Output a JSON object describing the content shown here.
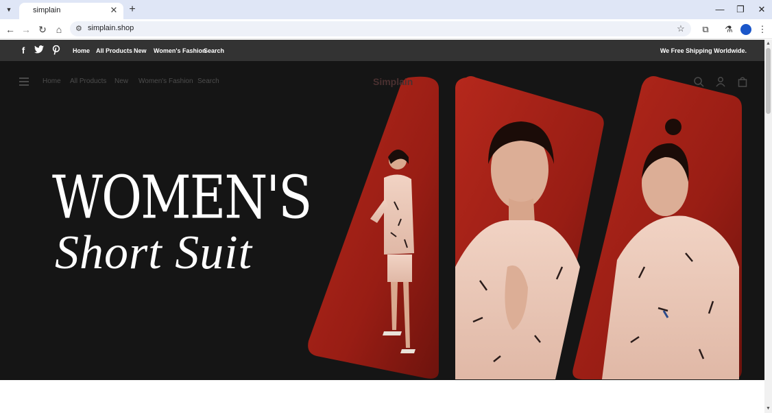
{
  "browser": {
    "tab_title": "simplain",
    "url": "simplain.shop",
    "icons": {
      "tab_list": "chevron-down-icon",
      "close": "close-icon",
      "new_tab": "plus-icon",
      "minimize": "minimize-icon",
      "restore": "restore-icon",
      "close_window": "close-icon",
      "back": "back-arrow-icon",
      "forward": "forward-arrow-icon",
      "reload": "reload-icon",
      "home": "home-icon",
      "site_info": "tune-icon",
      "bookmark": "star-icon",
      "extensions": "puzzle-icon",
      "labs": "flask-icon",
      "profile": "profile-icon",
      "menu": "kebab-menu-icon"
    }
  },
  "topbar": {
    "nav": [
      "Home",
      "All Products",
      "New",
      "Women's Fashion",
      "Search"
    ],
    "shipping": "We Free Shipping Worldwide.",
    "social": [
      "facebook-icon",
      "twitter-icon",
      "pinterest-icon"
    ],
    "background": "#333333"
  },
  "header": {
    "nav": [
      "Home",
      "All Products",
      "New",
      "Women's Fashion",
      "Search"
    ],
    "logo": "Simplain"
  },
  "hero": {
    "headline_line1": "WOMEN'S",
    "headline_line2": "Short Suit",
    "background": "#151515",
    "accent": "#a8231a"
  }
}
